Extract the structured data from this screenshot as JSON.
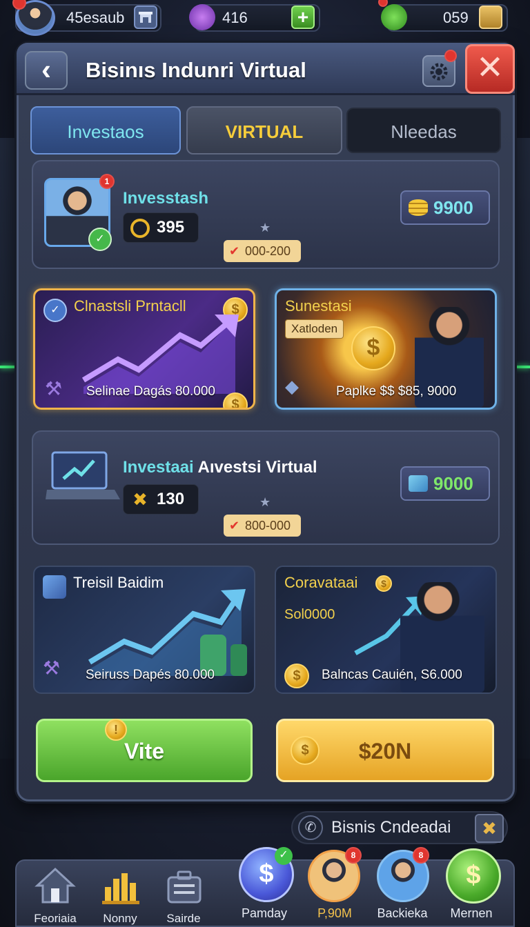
{
  "topbar": {
    "username": "45esaub",
    "gems": "416",
    "cash": "059",
    "avatar_badge": ""
  },
  "header": {
    "back": "‹",
    "title": "Bisinıs Indunri Virtual",
    "close": "✕",
    "gear_badge": ""
  },
  "tabs": [
    {
      "label": "Investaos"
    },
    {
      "label": "VIRTUAL"
    },
    {
      "label": "Nleedas"
    }
  ],
  "row1": {
    "title": "Invesstash",
    "value": "395",
    "range": "000-200",
    "amount": "9900",
    "portrait_badge": "1"
  },
  "card1": {
    "title": "Clnastsli Prntacll",
    "caption": "Selinae Dagás 80.000"
  },
  "card2": {
    "title": "Sunestasi",
    "tag": "Xatloden",
    "caption": "Paplke $$ $85, 9000"
  },
  "row2": {
    "title_a": "Investaai",
    "title_b": "Aıvestsi Virtual",
    "value": "130",
    "range": "800-000",
    "amount": "9000"
  },
  "card3": {
    "title": "Treisil Baidim",
    "caption": "Seiruss Dapés 80.000"
  },
  "card4": {
    "title": "Coravataai",
    "sub": "Sol0000",
    "caption": "Balncas Cauién, S6.000"
  },
  "buttons": {
    "left": "Vite",
    "right": "$20N"
  },
  "info": {
    "label": "Bisnis Cndeadai"
  },
  "nav": [
    {
      "label": "Feoriaia"
    },
    {
      "label": "Nonny"
    },
    {
      "label": "Sairde"
    },
    {
      "label": "Pamday"
    },
    {
      "label": "P,90M",
      "badge": "8"
    },
    {
      "label": "Backieka",
      "badge": "8"
    },
    {
      "label": "Mernen"
    }
  ],
  "colors": {
    "accent_cyan": "#6fe0e8",
    "accent_gold": "#f3d14d",
    "button_green": "#5db83a",
    "button_gold": "#f2bb3c",
    "close_red": "#d8433a"
  }
}
